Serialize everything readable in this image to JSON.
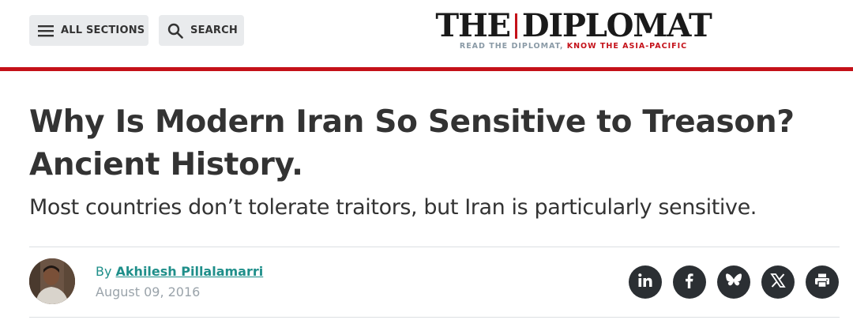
{
  "header": {
    "all_sections_label": "ALL SECTIONS",
    "search_label": "SEARCH",
    "logo_left": "THE",
    "logo_right": "DIPLOMAT",
    "tagline_part1": "READ THE DIPLOMAT, ",
    "tagline_part2": "KNOW THE ASIA-PACIFIC",
    "accent_color": "#c41119"
  },
  "article": {
    "headline": "Why Is Modern Iran So Sensitive to Treason? Ancient History.",
    "subhead": "Most countries don’t tolerate traitors, but Iran is particularly sensitive.",
    "byline_prefix": "By ",
    "author": "Akhilesh Pillalamarri",
    "date": "August 09, 2016"
  },
  "share": {
    "icons": [
      "linkedin-icon",
      "facebook-icon",
      "bluesky-icon",
      "x-icon",
      "print-icon"
    ]
  }
}
